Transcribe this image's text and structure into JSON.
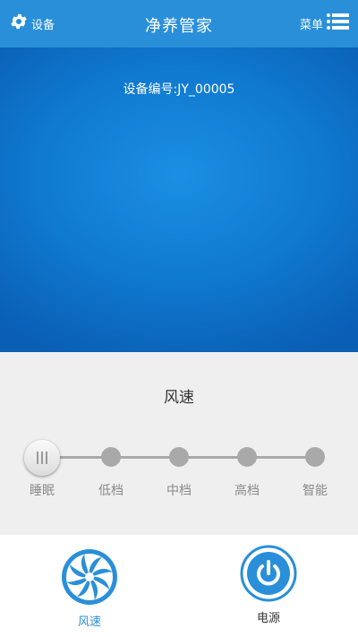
{
  "header": {
    "left_label": "设备",
    "left_icon": "gear-icon",
    "title": "净养管家",
    "right_label": "菜单",
    "right_icon": "list-menu-icon"
  },
  "device": {
    "id_text": "设备编号:JY_00005"
  },
  "speed": {
    "title": "风速",
    "options": [
      "睡眠",
      "低档",
      "中档",
      "高档",
      "智能"
    ],
    "selected": "睡眠"
  },
  "tabs": [
    {
      "label": "风速",
      "icon": "fan-icon",
      "active": true
    },
    {
      "label": "电源",
      "icon": "power-icon",
      "active": false
    }
  ],
  "colors": {
    "accent": "#2a8fd9",
    "hero": "#1b8fe3",
    "panel_bg": "#efefef",
    "slider_gray": "#a9a9a9"
  }
}
